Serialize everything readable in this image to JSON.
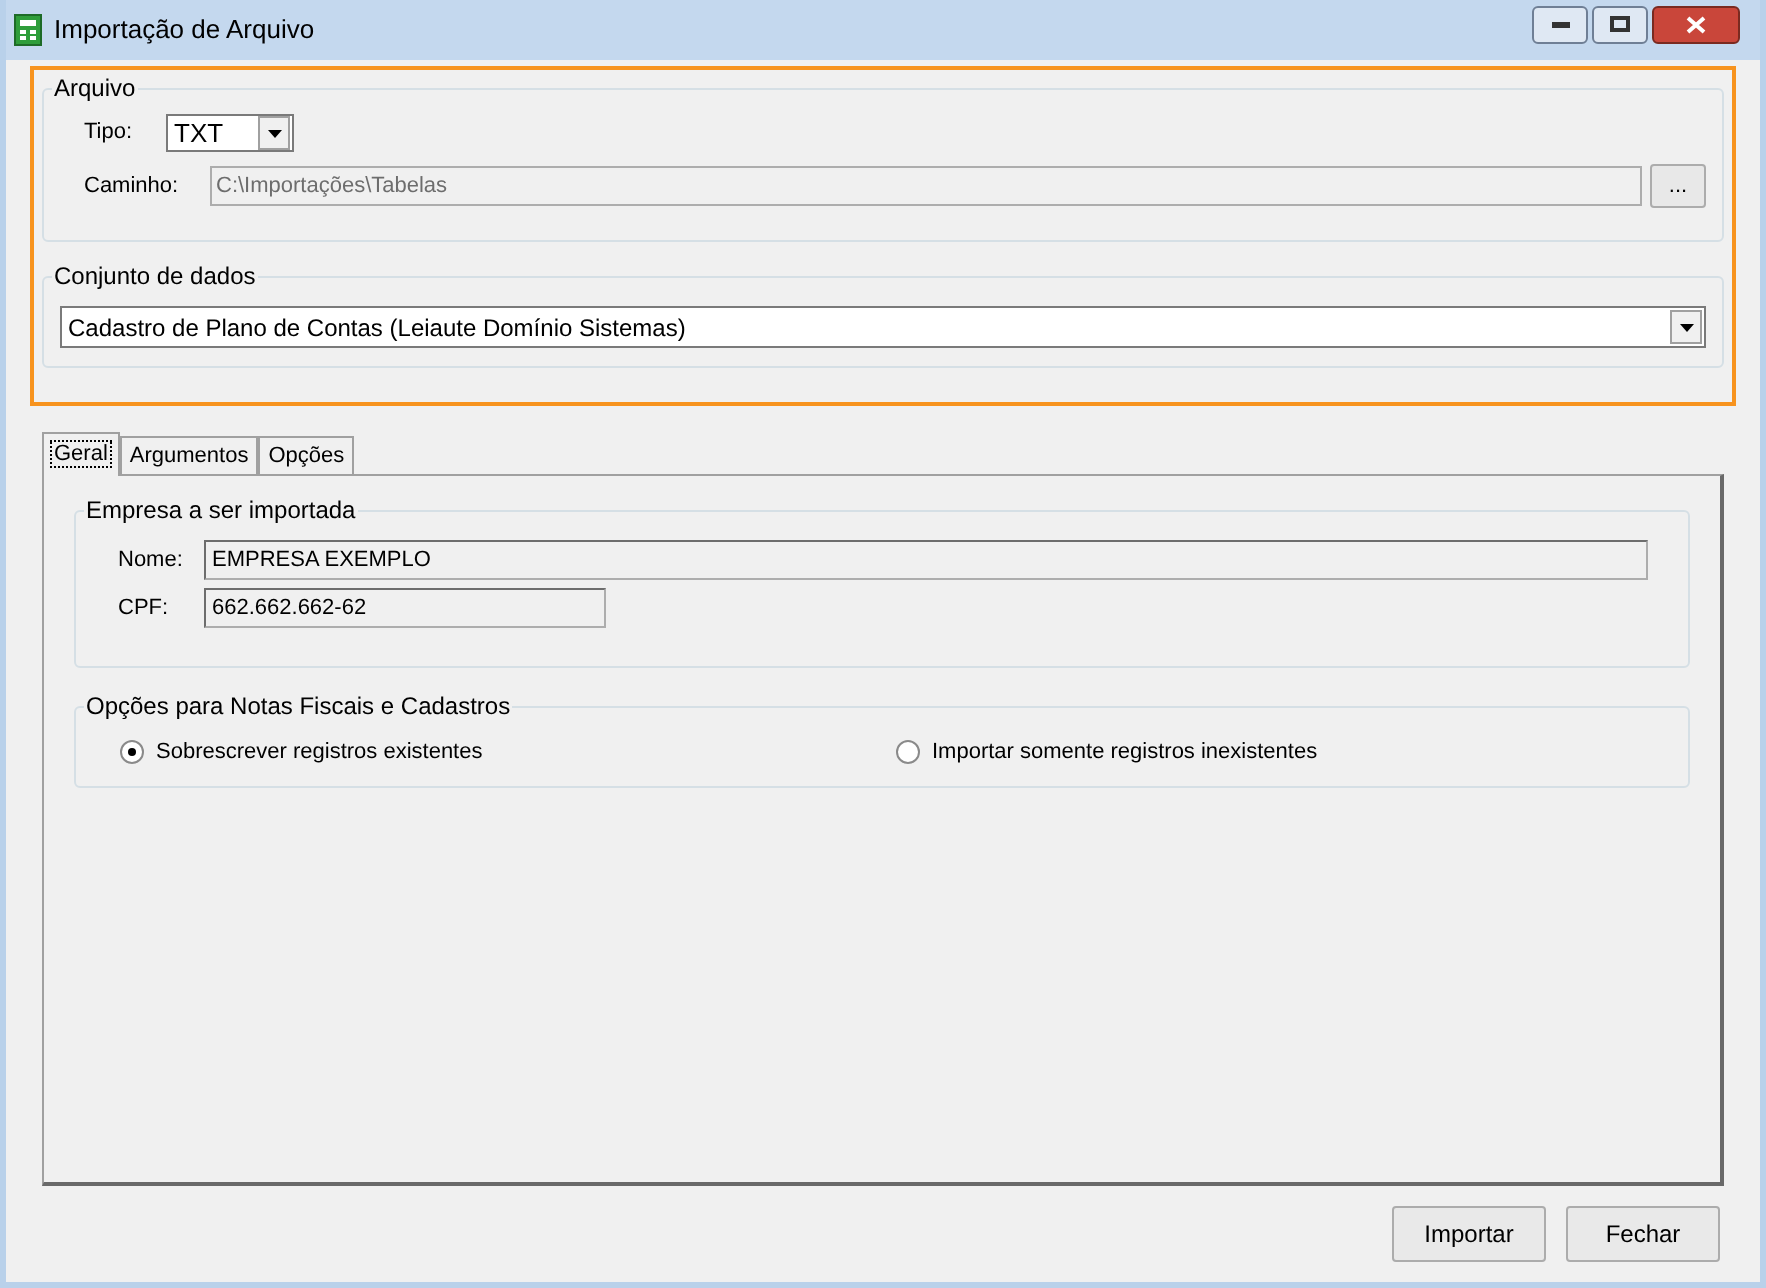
{
  "window": {
    "title": "Importação de Arquivo"
  },
  "arquivo": {
    "title": "Arquivo",
    "tipo": {
      "label": "Tipo:",
      "value": "TXT"
    },
    "caminho": {
      "label": "Caminho:",
      "value": "C:\\Importações\\Tabelas",
      "disabled": true,
      "browse_button": "..."
    }
  },
  "conjunto": {
    "title": "Conjunto de dados",
    "value": "Cadastro de Plano de Contas (Leiaute Domínio Sistemas)"
  },
  "tabs": [
    {
      "label": "Geral",
      "selected": true
    },
    {
      "label": "Argumentos",
      "selected": false
    },
    {
      "label": "Opções",
      "selected": false
    }
  ],
  "empresa": {
    "title": "Empresa a ser importada",
    "fields": [
      {
        "label": "Nome:",
        "value": "EMPRESA EXEMPLO"
      },
      {
        "label": "CPF:",
        "value": "662.662.662-62"
      }
    ]
  },
  "opcoes": {
    "title": "Opções para Notas Fiscais e Cadastros",
    "options": [
      {
        "label": "Sobrescrever registros existentes",
        "selected": true
      },
      {
        "label": "Importar somente registros inexistentes",
        "selected": false
      }
    ]
  },
  "buttons": [
    "Importar",
    "Fechar"
  ]
}
